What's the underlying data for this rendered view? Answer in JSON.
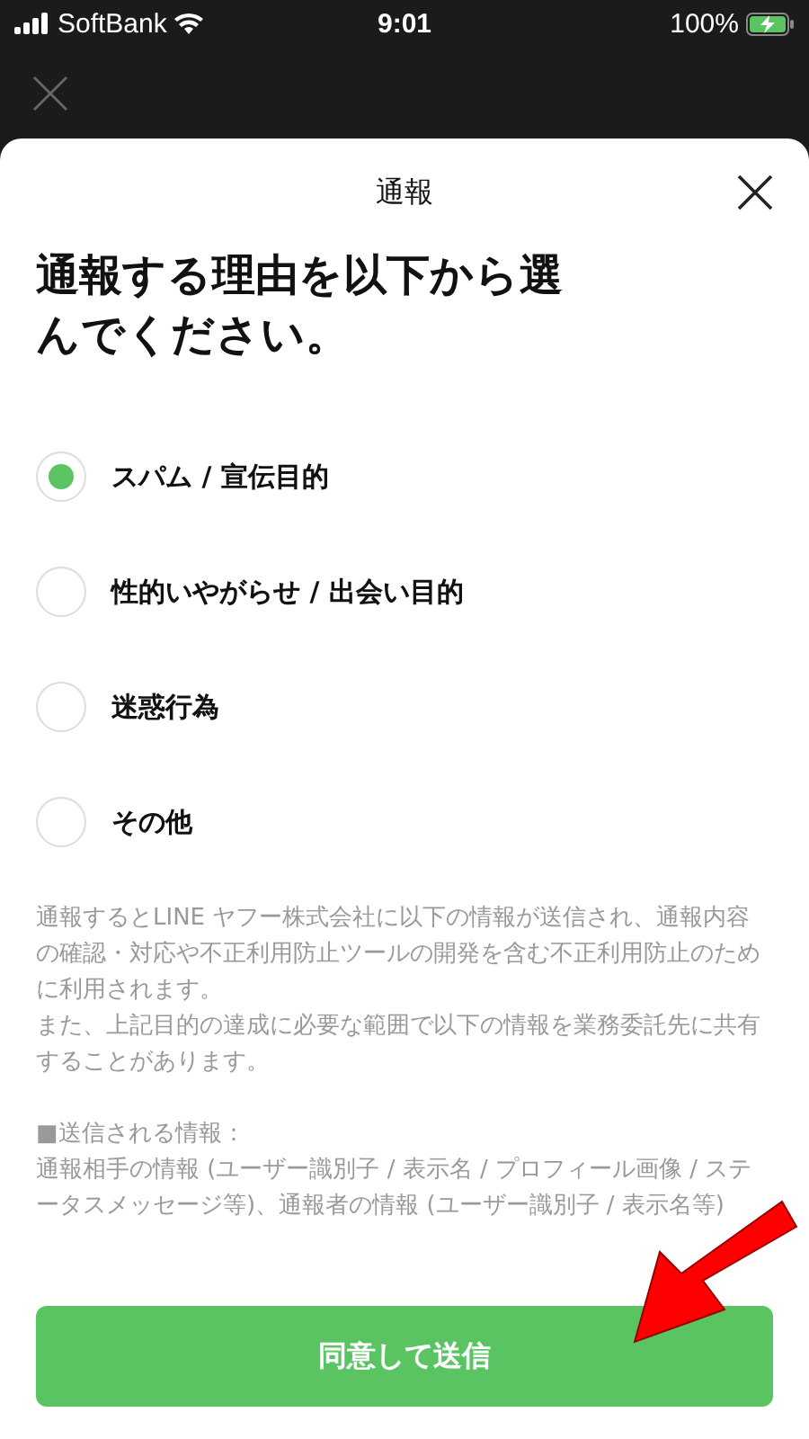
{
  "status_bar": {
    "carrier": "SoftBank",
    "time": "9:01",
    "battery": "100%"
  },
  "sheet": {
    "title": "通報",
    "heading": "通報する理由を以下から選んでください。"
  },
  "reasons": [
    {
      "label": "スパム / 宣伝目的",
      "selected": true
    },
    {
      "label": "性的いやがらせ / 出会い目的",
      "selected": false
    },
    {
      "label": "迷惑行為",
      "selected": false
    },
    {
      "label": "その他",
      "selected": false
    }
  ],
  "notice": [
    "通報するとLINE ヤフー株式会社に以下の情報が送信され、通報内容の確認・対応や不正利用防止ツールの開発を含む不正利用防止のために利用されます。",
    "また、上記目的の達成に必要な範囲で以下の情報を業務委託先に共有することがあります。"
  ],
  "sent_info": {
    "heading": "■送信される情報：",
    "text": "通報相手の情報 (ユーザー識別子 / 表示名 / プロフィール画像 / ステータスメッセージ等)、通報者の情報 (ユーザー識別子 / 表示名等)"
  },
  "button": "同意して送信"
}
